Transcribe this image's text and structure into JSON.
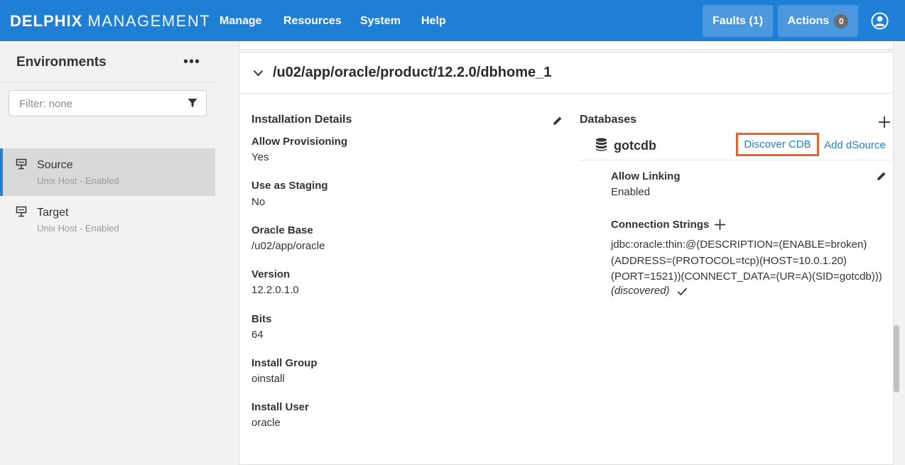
{
  "topbar": {
    "brand_bold": "DELPHIX",
    "brand_light": "MANAGEMENT",
    "nav": [
      "Manage",
      "Resources",
      "System",
      "Help"
    ],
    "faults_label": "Faults (1)",
    "actions_label": "Actions",
    "actions_count": "0",
    "accent": "#1f7fd4"
  },
  "sidebar": {
    "title": "Environments",
    "more": "•••",
    "filter_placeholder": "Filter: none",
    "environments": [
      {
        "name": "Source",
        "subtitle": "Unix Host - Enabled",
        "selected": true
      },
      {
        "name": "Target",
        "subtitle": "Unix Host - Enabled",
        "selected": false
      }
    ]
  },
  "main": {
    "path_title": "/u02/app/oracle/product/12.2.0/dbhome_1",
    "installation": {
      "title": "Installation Details",
      "fields": [
        {
          "label": "Allow Provisioning",
          "value": "Yes"
        },
        {
          "label": "Use as Staging",
          "value": "No"
        },
        {
          "label": "Oracle Base",
          "value": "/u02/app/oracle"
        },
        {
          "label": "Version",
          "value": "12.2.0.1.0"
        },
        {
          "label": "Bits",
          "value": "64"
        },
        {
          "label": "Install Group",
          "value": "oinstall"
        },
        {
          "label": "Install User",
          "value": "oracle"
        }
      ]
    },
    "databases": {
      "title": "Databases",
      "db_name": "gotcdb",
      "discover_cdb_label": "Discover CDB",
      "add_dsource_label": "Add dSource",
      "allow_linking_label": "Allow Linking",
      "allow_linking_value": "Enabled",
      "connection_strings_label": "Connection Strings",
      "connection_lines": [
        "jdbc:oracle:thin:@(DESCRIPTION=(ENABLE=broken)",
        "(ADDRESS=(PROTOCOL=tcp)(HOST=10.0.1.20)",
        "(PORT=1521))(CONNECT_DATA=(UR=A)(SID=gotcdb)))"
      ],
      "discovered_label": "(discovered)",
      "highlight_color": "#e8632b"
    }
  }
}
